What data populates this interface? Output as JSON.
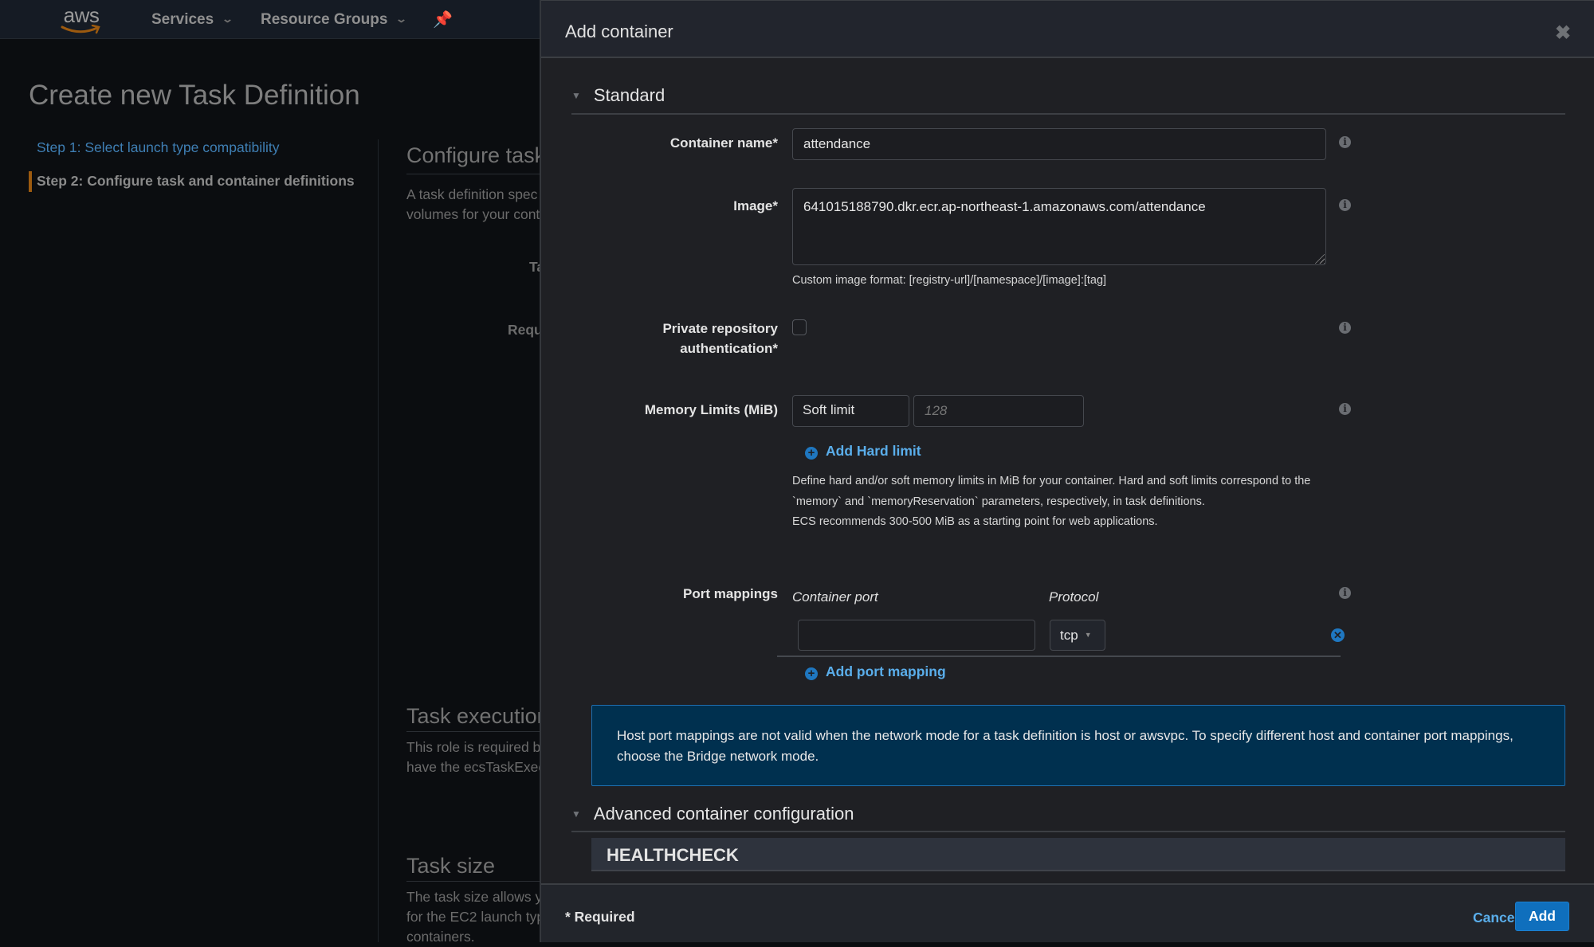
{
  "topnav": {
    "logo_text": "aws",
    "services_label": "Services",
    "resource_groups_label": "Resource Groups",
    "pin_icon": "pushpin-icon",
    "dropdown_icon": "chevron-down-icon"
  },
  "background_page": {
    "title": "Create new Task Definition",
    "steps": [
      {
        "label": "Step 1: Select launch type compatibility",
        "state": "link"
      },
      {
        "label": "Step 2: Configure task and container definitions",
        "state": "current"
      }
    ],
    "sections": [
      {
        "heading": "Configure task",
        "lines": [
          "A task definition spec",
          "volumes for your cont"
        ]
      },
      {
        "heading": "Task execution IA",
        "lines": [
          "This role is required b",
          "have the ecsTaskExec"
        ]
      },
      {
        "heading": "Task size",
        "lines": [
          "The task size allows y",
          "for the EC2 launch typ",
          "containers."
        ]
      }
    ],
    "field_labels": [
      "Ta",
      "Requ"
    ]
  },
  "modal": {
    "title": "Add container",
    "close_icon": "close-icon",
    "standard_section": {
      "heading": "Standard",
      "container_name": {
        "label": "Container name*",
        "value": "attendance"
      },
      "image": {
        "label": "Image*",
        "value": "641015188790.dkr.ecr.ap-northeast-1.amazonaws.com/attendance",
        "help": "Custom image format: [registry-url]/[namespace]/[image]:[tag]"
      },
      "private_repo_auth": {
        "label_line1": "Private repository",
        "label_line2": "authentication*",
        "checked": false
      },
      "memory_limits": {
        "label": "Memory Limits (MiB)",
        "limit_type": "Soft limit",
        "placeholder": "128",
        "add_hard_limit_label": "Add Hard limit",
        "help_lines": [
          "Define hard and/or soft memory limits in MiB for your container. Hard and soft limits correspond to the",
          "`memory` and `memoryReservation` parameters, respectively, in task definitions.",
          "ECS recommends 300-500 MiB as a starting point for web applications."
        ]
      },
      "port_mappings": {
        "label": "Port mappings",
        "col_container_port": "Container port",
        "col_protocol": "Protocol",
        "rows": [
          {
            "container_port": "",
            "protocol": "tcp"
          }
        ],
        "add_label": "Add port mapping"
      },
      "info_message": "Host port mappings are not valid when the network mode for a task definition is host or awsvpc. To specify different host and container port mappings, choose the Bridge network mode."
    },
    "advanced_section": {
      "heading": "Advanced container configuration",
      "subsection": "HEALTHCHECK"
    },
    "footer": {
      "required_note": "* Required",
      "cancel_label": "Cancel",
      "add_label": "Add"
    },
    "colors": {
      "link": "#5aaeeb",
      "primary_button": "#0f6fbd",
      "info_bg": "#00304f",
      "step_accent": "#9c5a0f"
    }
  }
}
